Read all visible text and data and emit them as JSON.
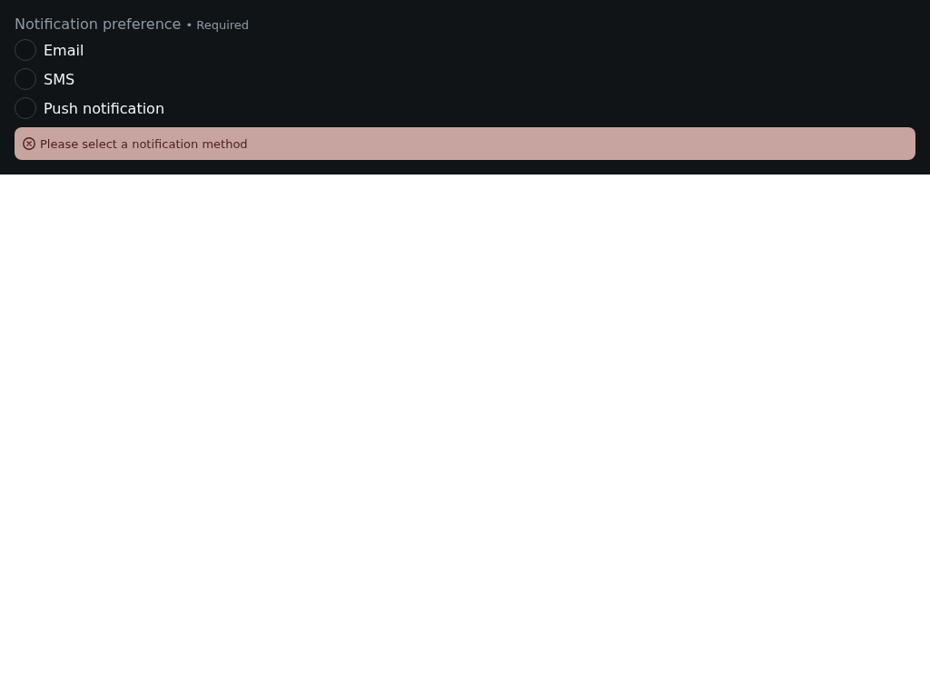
{
  "field": {
    "label": "Notification preference",
    "required_mark": "• Required",
    "options": [
      {
        "label": "Email",
        "selected": false
      },
      {
        "label": "SMS",
        "selected": false
      },
      {
        "label": "Push notification",
        "selected": false
      }
    ],
    "error": "Please select a notification method"
  }
}
